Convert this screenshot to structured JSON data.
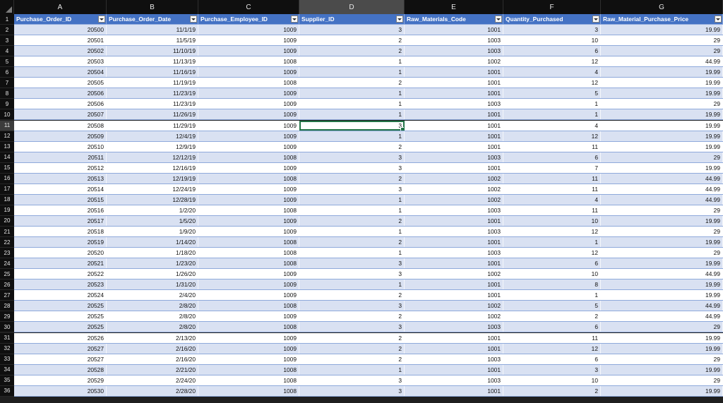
{
  "columns": [
    "A",
    "B",
    "C",
    "D",
    "E",
    "F",
    "G"
  ],
  "selected_column": "D",
  "active_row_number": "11",
  "header_row_number": "1",
  "headers": [
    "Purchase_Order_ID",
    "Purchase_Order_Date",
    "Purchase_Employee_ID",
    "Supplier_ID",
    "Raw_Materials_Code",
    "Quantity_Purchased",
    "Raw_Material_Purchase_Price"
  ],
  "rows": [
    [
      "2",
      "20500",
      "11/1/19",
      "1009",
      "3",
      "1001",
      "3",
      "19.99"
    ],
    [
      "3",
      "20501",
      "11/5/19",
      "1009",
      "2",
      "1003",
      "10",
      "29"
    ],
    [
      "4",
      "20502",
      "11/10/19",
      "1009",
      "2",
      "1003",
      "6",
      "29"
    ],
    [
      "5",
      "20503",
      "11/13/19",
      "1008",
      "1",
      "1002",
      "12",
      "44.99"
    ],
    [
      "6",
      "20504",
      "11/16/19",
      "1009",
      "1",
      "1001",
      "4",
      "19.99"
    ],
    [
      "7",
      "20505",
      "11/19/19",
      "1008",
      "2",
      "1001",
      "12",
      "19.99"
    ],
    [
      "8",
      "20506",
      "11/23/19",
      "1009",
      "1",
      "1001",
      "5",
      "19.99"
    ],
    [
      "9",
      "20506",
      "11/23/19",
      "1009",
      "1",
      "1003",
      "1",
      "29"
    ],
    [
      "10",
      "20507",
      "11/26/19",
      "1009",
      "1",
      "1001",
      "1",
      "19.99"
    ],
    [
      "11",
      "20508",
      "11/29/19",
      "1009",
      "3",
      "1001",
      "4",
      "19.99"
    ],
    [
      "12",
      "20509",
      "12/4/19",
      "1009",
      "1",
      "1001",
      "12",
      "19.99"
    ],
    [
      "13",
      "20510",
      "12/9/19",
      "1009",
      "2",
      "1001",
      "11",
      "19.99"
    ],
    [
      "14",
      "20511",
      "12/12/19",
      "1008",
      "3",
      "1003",
      "6",
      "29"
    ],
    [
      "15",
      "20512",
      "12/16/19",
      "1009",
      "3",
      "1001",
      "7",
      "19.99"
    ],
    [
      "16",
      "20513",
      "12/19/19",
      "1008",
      "2",
      "1002",
      "11",
      "44.99"
    ],
    [
      "17",
      "20514",
      "12/24/19",
      "1009",
      "3",
      "1002",
      "11",
      "44.99"
    ],
    [
      "18",
      "20515",
      "12/28/19",
      "1009",
      "1",
      "1002",
      "4",
      "44.99"
    ],
    [
      "19",
      "20516",
      "1/2/20",
      "1008",
      "1",
      "1003",
      "11",
      "29"
    ],
    [
      "20",
      "20517",
      "1/5/20",
      "1009",
      "2",
      "1001",
      "10",
      "19.99"
    ],
    [
      "21",
      "20518",
      "1/9/20",
      "1009",
      "1",
      "1003",
      "12",
      "29"
    ],
    [
      "22",
      "20519",
      "1/14/20",
      "1008",
      "2",
      "1001",
      "1",
      "19.99"
    ],
    [
      "23",
      "20520",
      "1/18/20",
      "1008",
      "1",
      "1003",
      "12",
      "29"
    ],
    [
      "24",
      "20521",
      "1/23/20",
      "1008",
      "3",
      "1001",
      "6",
      "19.99"
    ],
    [
      "25",
      "20522",
      "1/26/20",
      "1009",
      "3",
      "1002",
      "10",
      "44.99"
    ],
    [
      "26",
      "20523",
      "1/31/20",
      "1009",
      "1",
      "1001",
      "8",
      "19.99"
    ],
    [
      "27",
      "20524",
      "2/4/20",
      "1009",
      "2",
      "1001",
      "1",
      "19.99"
    ],
    [
      "28",
      "20525",
      "2/8/20",
      "1008",
      "3",
      "1002",
      "5",
      "44.99"
    ],
    [
      "29",
      "20525",
      "2/8/20",
      "1009",
      "2",
      "1002",
      "2",
      "44.99"
    ],
    [
      "30",
      "20525",
      "2/8/20",
      "1008",
      "3",
      "1003",
      "6",
      "29"
    ],
    [
      "31",
      "20526",
      "2/13/20",
      "1009",
      "2",
      "1001",
      "11",
      "19.99"
    ],
    [
      "32",
      "20527",
      "2/16/20",
      "1009",
      "2",
      "1001",
      "12",
      "19.99"
    ],
    [
      "33",
      "20527",
      "2/16/20",
      "1009",
      "2",
      "1003",
      "6",
      "29"
    ],
    [
      "34",
      "20528",
      "2/21/20",
      "1008",
      "1",
      "1001",
      "3",
      "19.99"
    ],
    [
      "35",
      "20529",
      "2/24/20",
      "1008",
      "3",
      "1003",
      "10",
      "29"
    ],
    [
      "36",
      "20530",
      "2/28/20",
      "1008",
      "3",
      "1001",
      "2",
      "19.99"
    ]
  ],
  "colors": {
    "header_fill": "#4472c4",
    "band_fill": "#d9e1f2",
    "active_border": "#217346"
  }
}
